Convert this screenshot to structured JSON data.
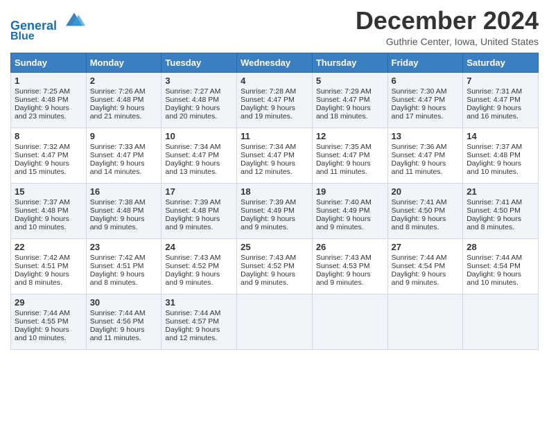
{
  "header": {
    "logo_line1": "General",
    "logo_line2": "Blue",
    "month_title": "December 2024",
    "location": "Guthrie Center, Iowa, United States"
  },
  "days_of_week": [
    "Sunday",
    "Monday",
    "Tuesday",
    "Wednesday",
    "Thursday",
    "Friday",
    "Saturday"
  ],
  "weeks": [
    [
      {
        "day": "1",
        "sunrise": "Sunrise: 7:25 AM",
        "sunset": "Sunset: 4:48 PM",
        "daylight": "Daylight: 9 hours and 23 minutes."
      },
      {
        "day": "2",
        "sunrise": "Sunrise: 7:26 AM",
        "sunset": "Sunset: 4:48 PM",
        "daylight": "Daylight: 9 hours and 21 minutes."
      },
      {
        "day": "3",
        "sunrise": "Sunrise: 7:27 AM",
        "sunset": "Sunset: 4:48 PM",
        "daylight": "Daylight: 9 hours and 20 minutes."
      },
      {
        "day": "4",
        "sunrise": "Sunrise: 7:28 AM",
        "sunset": "Sunset: 4:47 PM",
        "daylight": "Daylight: 9 hours and 19 minutes."
      },
      {
        "day": "5",
        "sunrise": "Sunrise: 7:29 AM",
        "sunset": "Sunset: 4:47 PM",
        "daylight": "Daylight: 9 hours and 18 minutes."
      },
      {
        "day": "6",
        "sunrise": "Sunrise: 7:30 AM",
        "sunset": "Sunset: 4:47 PM",
        "daylight": "Daylight: 9 hours and 17 minutes."
      },
      {
        "day": "7",
        "sunrise": "Sunrise: 7:31 AM",
        "sunset": "Sunset: 4:47 PM",
        "daylight": "Daylight: 9 hours and 16 minutes."
      }
    ],
    [
      {
        "day": "8",
        "sunrise": "Sunrise: 7:32 AM",
        "sunset": "Sunset: 4:47 PM",
        "daylight": "Daylight: 9 hours and 15 minutes."
      },
      {
        "day": "9",
        "sunrise": "Sunrise: 7:33 AM",
        "sunset": "Sunset: 4:47 PM",
        "daylight": "Daylight: 9 hours and 14 minutes."
      },
      {
        "day": "10",
        "sunrise": "Sunrise: 7:34 AM",
        "sunset": "Sunset: 4:47 PM",
        "daylight": "Daylight: 9 hours and 13 minutes."
      },
      {
        "day": "11",
        "sunrise": "Sunrise: 7:34 AM",
        "sunset": "Sunset: 4:47 PM",
        "daylight": "Daylight: 9 hours and 12 minutes."
      },
      {
        "day": "12",
        "sunrise": "Sunrise: 7:35 AM",
        "sunset": "Sunset: 4:47 PM",
        "daylight": "Daylight: 9 hours and 11 minutes."
      },
      {
        "day": "13",
        "sunrise": "Sunrise: 7:36 AM",
        "sunset": "Sunset: 4:47 PM",
        "daylight": "Daylight: 9 hours and 11 minutes."
      },
      {
        "day": "14",
        "sunrise": "Sunrise: 7:37 AM",
        "sunset": "Sunset: 4:48 PM",
        "daylight": "Daylight: 9 hours and 10 minutes."
      }
    ],
    [
      {
        "day": "15",
        "sunrise": "Sunrise: 7:37 AM",
        "sunset": "Sunset: 4:48 PM",
        "daylight": "Daylight: 9 hours and 10 minutes."
      },
      {
        "day": "16",
        "sunrise": "Sunrise: 7:38 AM",
        "sunset": "Sunset: 4:48 PM",
        "daylight": "Daylight: 9 hours and 9 minutes."
      },
      {
        "day": "17",
        "sunrise": "Sunrise: 7:39 AM",
        "sunset": "Sunset: 4:48 PM",
        "daylight": "Daylight: 9 hours and 9 minutes."
      },
      {
        "day": "18",
        "sunrise": "Sunrise: 7:39 AM",
        "sunset": "Sunset: 4:49 PM",
        "daylight": "Daylight: 9 hours and 9 minutes."
      },
      {
        "day": "19",
        "sunrise": "Sunrise: 7:40 AM",
        "sunset": "Sunset: 4:49 PM",
        "daylight": "Daylight: 9 hours and 9 minutes."
      },
      {
        "day": "20",
        "sunrise": "Sunrise: 7:41 AM",
        "sunset": "Sunset: 4:50 PM",
        "daylight": "Daylight: 9 hours and 8 minutes."
      },
      {
        "day": "21",
        "sunrise": "Sunrise: 7:41 AM",
        "sunset": "Sunset: 4:50 PM",
        "daylight": "Daylight: 9 hours and 8 minutes."
      }
    ],
    [
      {
        "day": "22",
        "sunrise": "Sunrise: 7:42 AM",
        "sunset": "Sunset: 4:51 PM",
        "daylight": "Daylight: 9 hours and 8 minutes."
      },
      {
        "day": "23",
        "sunrise": "Sunrise: 7:42 AM",
        "sunset": "Sunset: 4:51 PM",
        "daylight": "Daylight: 9 hours and 8 minutes."
      },
      {
        "day": "24",
        "sunrise": "Sunrise: 7:43 AM",
        "sunset": "Sunset: 4:52 PM",
        "daylight": "Daylight: 9 hours and 9 minutes."
      },
      {
        "day": "25",
        "sunrise": "Sunrise: 7:43 AM",
        "sunset": "Sunset: 4:52 PM",
        "daylight": "Daylight: 9 hours and 9 minutes."
      },
      {
        "day": "26",
        "sunrise": "Sunrise: 7:43 AM",
        "sunset": "Sunset: 4:53 PM",
        "daylight": "Daylight: 9 hours and 9 minutes."
      },
      {
        "day": "27",
        "sunrise": "Sunrise: 7:44 AM",
        "sunset": "Sunset: 4:54 PM",
        "daylight": "Daylight: 9 hours and 9 minutes."
      },
      {
        "day": "28",
        "sunrise": "Sunrise: 7:44 AM",
        "sunset": "Sunset: 4:54 PM",
        "daylight": "Daylight: 9 hours and 10 minutes."
      }
    ],
    [
      {
        "day": "29",
        "sunrise": "Sunrise: 7:44 AM",
        "sunset": "Sunset: 4:55 PM",
        "daylight": "Daylight: 9 hours and 10 minutes."
      },
      {
        "day": "30",
        "sunrise": "Sunrise: 7:44 AM",
        "sunset": "Sunset: 4:56 PM",
        "daylight": "Daylight: 9 hours and 11 minutes."
      },
      {
        "day": "31",
        "sunrise": "Sunrise: 7:44 AM",
        "sunset": "Sunset: 4:57 PM",
        "daylight": "Daylight: 9 hours and 12 minutes."
      },
      null,
      null,
      null,
      null
    ]
  ]
}
